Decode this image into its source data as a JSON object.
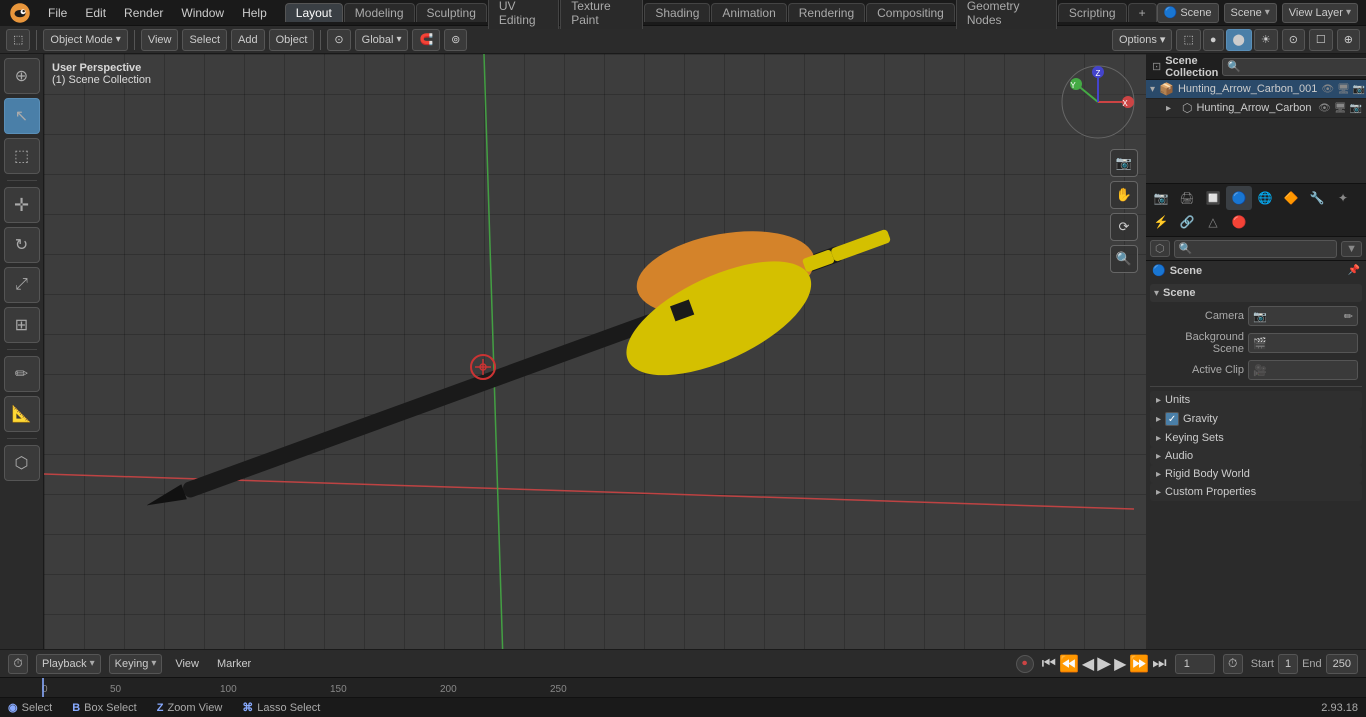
{
  "app": {
    "title": "Blender",
    "version": "2.93.18"
  },
  "menubar": {
    "logo_char": "⬡",
    "menus": [
      "File",
      "Edit",
      "Render",
      "Window",
      "Help"
    ],
    "workspaces": [
      "Layout",
      "Modeling",
      "Sculpting",
      "UV Editing",
      "Texture Paint",
      "Shading",
      "Animation",
      "Rendering",
      "Compositing",
      "Geometry Nodes",
      "Scripting"
    ],
    "active_workspace": "Layout",
    "plus_label": "+",
    "scene_label": "Scene",
    "view_layer_label": "View Layer"
  },
  "editor_toolbar": {
    "mode_label": "Object Mode",
    "view_label": "View",
    "select_label": "Select",
    "add_label": "Add",
    "object_label": "Object",
    "global_label": "Global",
    "options_label": "Options ▾"
  },
  "viewport": {
    "view_type": "User Perspective",
    "collection": "(1) Scene Collection"
  },
  "outliner": {
    "title": "Scene Collection",
    "search_placeholder": "🔍",
    "items": [
      {
        "id": 0,
        "indent": 0,
        "expand": "▾",
        "icon": "📦",
        "icon_color": "#e8963c",
        "label": "Hunting_Arrow_Carbon_001",
        "selected": true,
        "actions": [
          "👁",
          "🖥",
          "📷"
        ]
      },
      {
        "id": 1,
        "indent": 1,
        "expand": "▸",
        "icon": "⬡",
        "icon_color": "#aaa",
        "label": "Hunting_Arrow_Carbon",
        "selected": false,
        "actions": [
          "👁",
          "🖥",
          "📷"
        ]
      }
    ]
  },
  "properties": {
    "title": "Scene",
    "icon_tabs": [
      {
        "id": "render",
        "icon": "📷",
        "active": false
      },
      {
        "id": "output",
        "icon": "🖨",
        "active": false
      },
      {
        "id": "view-layer",
        "icon": "🔲",
        "active": false
      },
      {
        "id": "scene",
        "icon": "🔵",
        "active": true
      },
      {
        "id": "world",
        "icon": "🌐",
        "active": false
      },
      {
        "id": "object",
        "icon": "🔶",
        "active": false
      },
      {
        "id": "modifier",
        "icon": "🔧",
        "active": false
      },
      {
        "id": "particles",
        "icon": "✦",
        "active": false
      },
      {
        "id": "physics",
        "icon": "⚡",
        "active": false
      },
      {
        "id": "constraints",
        "icon": "🔗",
        "active": false
      },
      {
        "id": "object-data",
        "icon": "△",
        "active": false
      },
      {
        "id": "material",
        "icon": "🔴",
        "active": false
      },
      {
        "id": "shader",
        "icon": "🟡",
        "active": false
      }
    ],
    "section_scene": {
      "title": "Scene",
      "expanded": true,
      "camera_label": "Camera",
      "camera_value": "",
      "camera_icon": "📷",
      "background_scene_label": "Background Scene",
      "background_scene_icon": "🎬",
      "active_clip_label": "Active Clip",
      "active_clip_icon": "🎥"
    },
    "sections": [
      {
        "id": "units",
        "label": "Units",
        "expanded": false
      },
      {
        "id": "gravity",
        "label": "Gravity",
        "expanded": false,
        "has_checkbox": true,
        "checkbox_checked": true
      },
      {
        "id": "keying-sets",
        "label": "Keying Sets",
        "expanded": false
      },
      {
        "id": "audio",
        "label": "Audio",
        "expanded": false
      },
      {
        "id": "rigid-body-world",
        "label": "Rigid Body World",
        "expanded": false
      },
      {
        "id": "custom-properties",
        "label": "Custom Properties",
        "expanded": false
      }
    ]
  },
  "timeline": {
    "playback_label": "Playback",
    "keying_label": "Keying",
    "view_label": "View",
    "marker_label": "Marker",
    "current_frame": "1",
    "start_label": "Start",
    "start_value": "1",
    "end_label": "End",
    "end_value": "250",
    "frame_numbers": [
      "0",
      "50",
      "100",
      "150",
      "200",
      "250"
    ],
    "playback_icon": "⏵",
    "rewind_icon": "⏮",
    "prev_keyframe_icon": "⏪",
    "play_icon": "▶",
    "next_keyframe_icon": "⏩",
    "ffwd_icon": "⏭"
  },
  "status_bar": {
    "select_label": "Select",
    "box_select_label": "Box Select",
    "zoom_view_label": "Zoom View",
    "lasso_label": "Lasso Select",
    "version": "2.93.18",
    "current_frame_num": "1"
  },
  "left_tools": [
    {
      "id": "cursor",
      "icon": "⊕",
      "active": false
    },
    {
      "id": "select",
      "icon": "↖",
      "active": true
    },
    {
      "id": "select-box",
      "icon": "⬚",
      "active": false
    },
    {
      "sep": true
    },
    {
      "id": "move",
      "icon": "✛",
      "active": false
    },
    {
      "id": "rotate",
      "icon": "↻",
      "active": false
    },
    {
      "id": "scale",
      "icon": "⤢",
      "active": false
    },
    {
      "id": "transform",
      "icon": "⊞",
      "active": false
    },
    {
      "sep": true
    },
    {
      "id": "annotate",
      "icon": "✏",
      "active": false
    },
    {
      "id": "measure",
      "icon": "📏",
      "active": false
    },
    {
      "sep": true
    },
    {
      "id": "add-obj",
      "icon": "⬡",
      "active": false
    }
  ],
  "colors": {
    "accent_orange": "#e8963c",
    "accent_blue": "#4a7fa8",
    "bg_dark": "#1a1a1a",
    "bg_mid": "#2b2b2b",
    "bg_panel": "#2f2f2f",
    "grid_line": "rgba(0,0,0,0.25)",
    "red_axis": "#cc4444",
    "green_axis": "#44aa44",
    "blue_axis": "#4444cc"
  }
}
